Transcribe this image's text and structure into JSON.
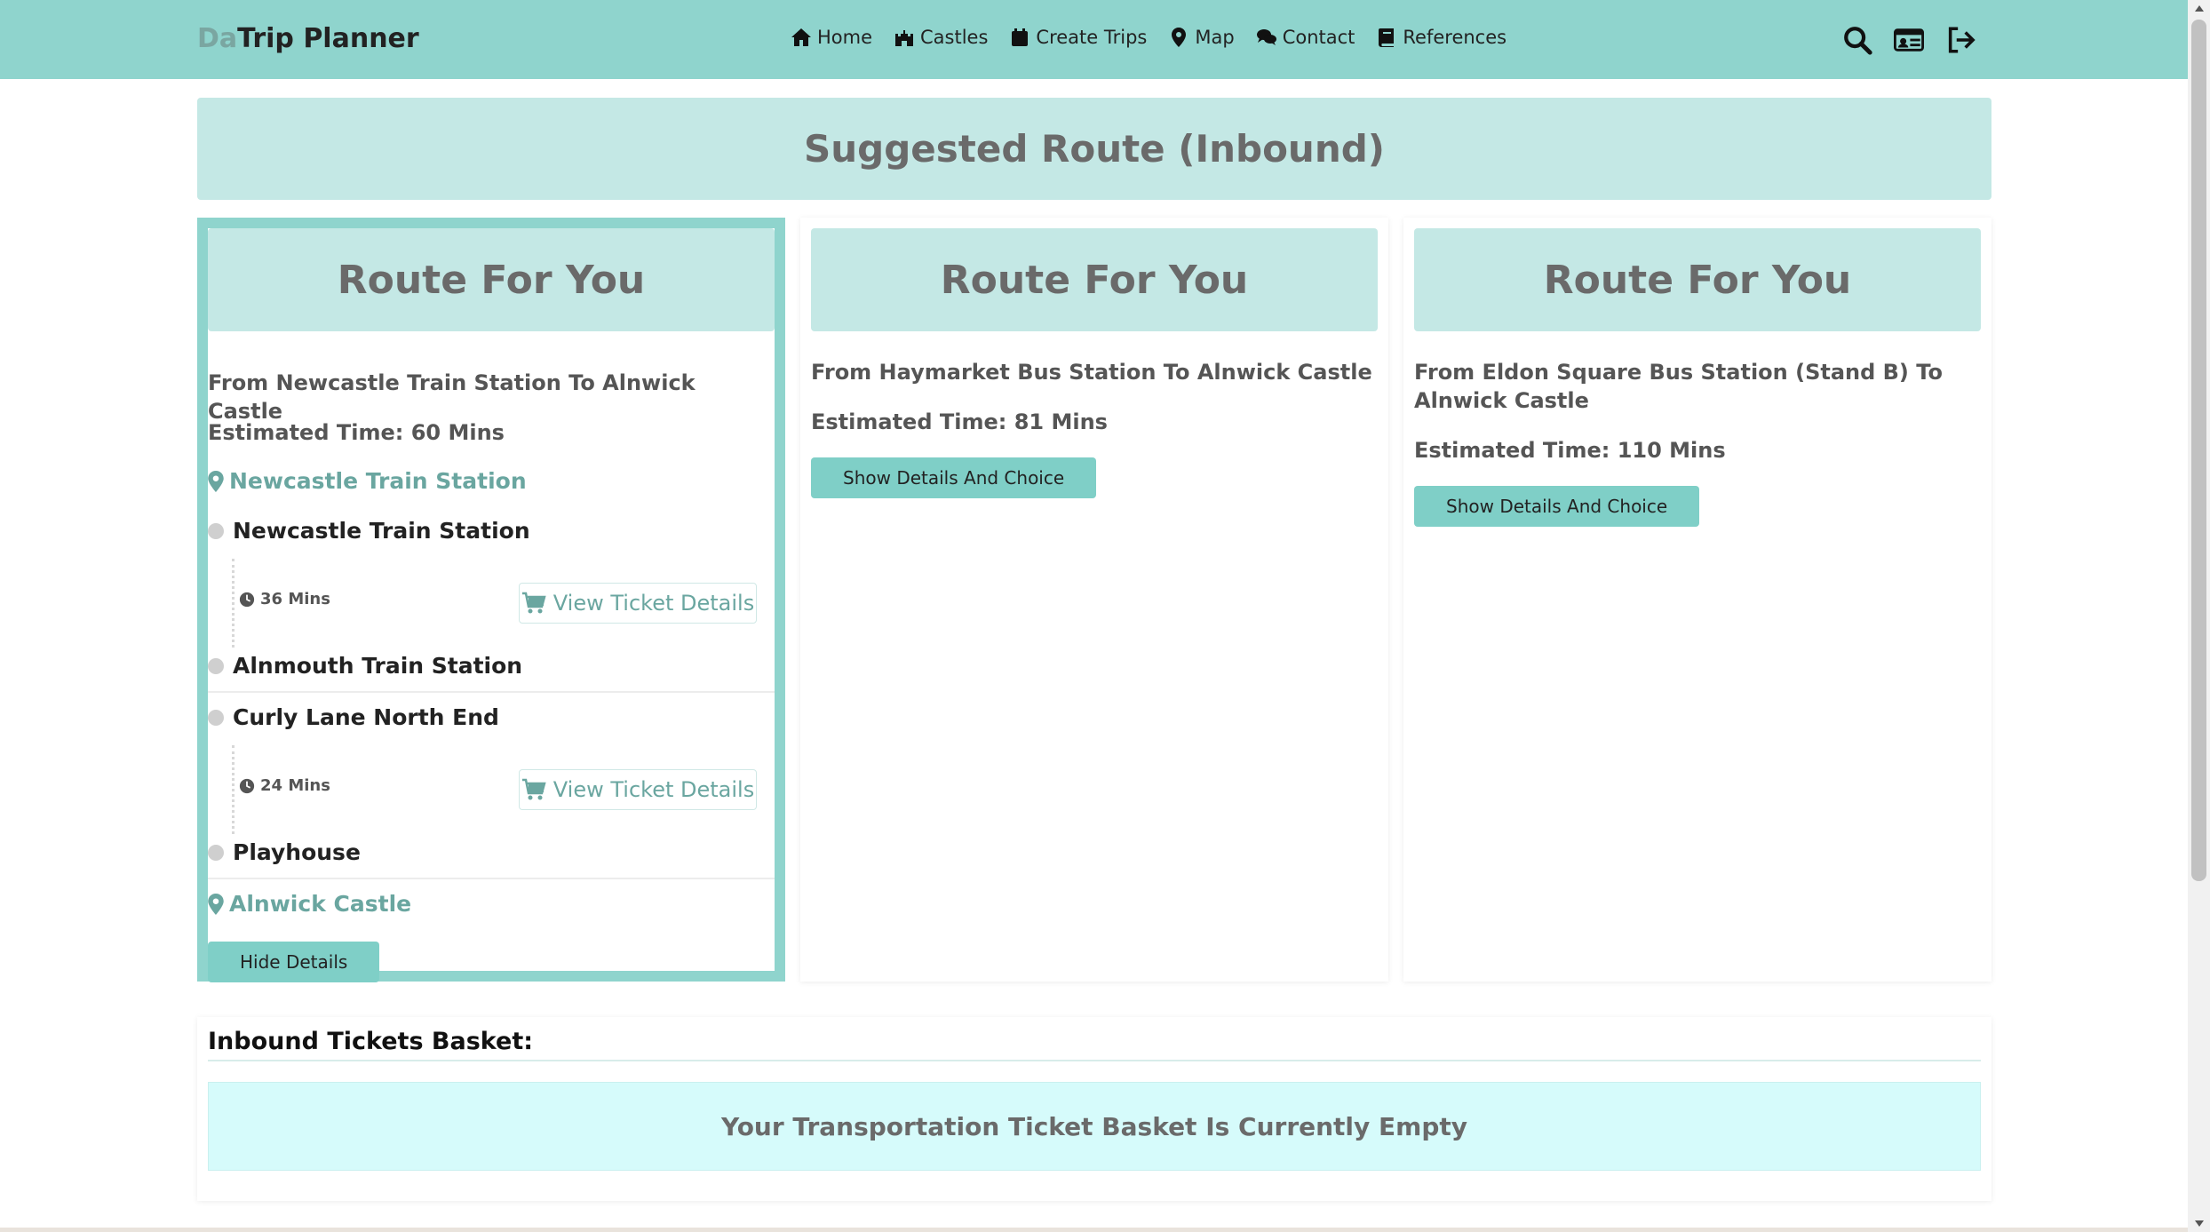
{
  "navbar": {
    "brand_prefix": "Da",
    "brand_main": "Trip Planner",
    "links": [
      {
        "label": "Home",
        "icon": "home-icon"
      },
      {
        "label": "Castles",
        "icon": "castle-icon"
      },
      {
        "label": "Create Trips",
        "icon": "calendar-icon"
      },
      {
        "label": "Map",
        "icon": "map-marker-icon"
      },
      {
        "label": "Contact",
        "icon": "comments-icon"
      },
      {
        "label": "References",
        "icon": "book-icon"
      }
    ],
    "right_icons": [
      "search-icon",
      "id-card-icon",
      "logout-icon"
    ]
  },
  "page": {
    "title": "Suggested Route (Inbound)"
  },
  "routes": [
    {
      "header": "Route For You",
      "from_to": "From Newcastle Train Station To Alnwick Castle",
      "estimated_time": "Estimated Time: 60 Mins",
      "expanded": true,
      "start_location": "Newcastle Train Station",
      "legs": [
        {
          "from": "Newcastle Train Station",
          "duration": "36 Mins",
          "ticket_label": "View Ticket Details",
          "to": "Alnmouth Train Station"
        },
        {
          "from": "Curly Lane North End",
          "duration": "24 Mins",
          "ticket_label": "View Ticket Details",
          "to": "Playhouse"
        }
      ],
      "end_location": "Alnwick Castle",
      "button_label": "Hide Details"
    },
    {
      "header": "Route For You",
      "from_to": "From Haymarket Bus Station To Alnwick Castle",
      "estimated_time": "Estimated Time: 81 Mins",
      "expanded": false,
      "button_label": "Show Details And Choice"
    },
    {
      "header": "Route For You",
      "from_to": "From Eldon Square Bus Station (Stand B) To Alnwick Castle",
      "estimated_time": "Estimated Time: 110 Mins",
      "expanded": false,
      "button_label": "Show Details And Choice"
    }
  ],
  "basket": {
    "title": "Inbound Tickets Basket:",
    "empty_message": "Your Transportation Ticket Basket Is Currently Empty"
  },
  "colors": {
    "accent": "#8fd4cd",
    "accent_light": "#c4e8e5",
    "location_text": "#6aa6a0",
    "basket_empty_bg": "#d6fbfb"
  }
}
